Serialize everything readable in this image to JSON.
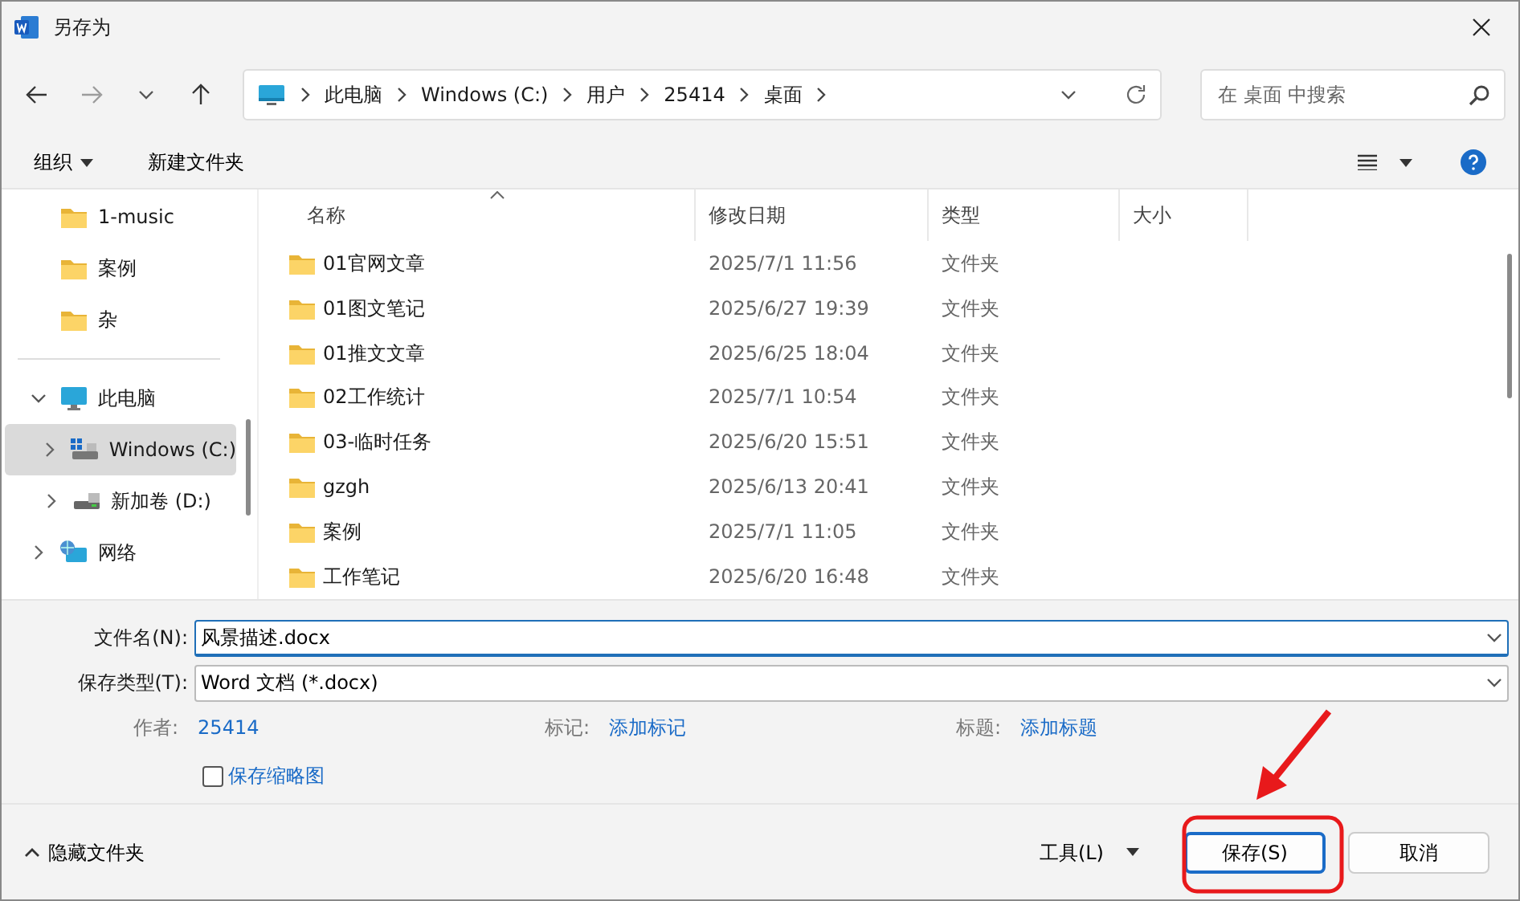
{
  "window": {
    "title": "另存为"
  },
  "nav": {
    "back_disabled": false,
    "forward_disabled": true,
    "breadcrumb": [
      "此电脑",
      "Windows (C:)",
      "用户",
      "25414",
      "桌面"
    ],
    "search": {
      "placeholder": "在 桌面 中搜索"
    }
  },
  "toolbar": {
    "organize": "组织",
    "new_folder": "新建文件夹"
  },
  "sidebar": {
    "items": [
      {
        "label": "1-music",
        "kind": "folder",
        "selected": false
      },
      {
        "label": "案例",
        "kind": "folder",
        "selected": false
      },
      {
        "label": "杂",
        "kind": "folder",
        "selected": false
      },
      {
        "label": "此电脑",
        "kind": "pc",
        "selected": false,
        "expanded": true,
        "children": [
          {
            "label": "Windows (C:)",
            "kind": "system-drive",
            "selected": true,
            "expanded": false
          },
          {
            "label": "新加卷 (D:)",
            "kind": "drive",
            "selected": false,
            "expanded": false
          }
        ]
      },
      {
        "label": "网络",
        "kind": "network",
        "selected": false,
        "expanded": false
      }
    ]
  },
  "table": {
    "columns": [
      {
        "label": "名称",
        "sorted": true
      },
      {
        "label": "修改日期",
        "sorted": false
      },
      {
        "label": "类型",
        "sorted": false
      },
      {
        "label": "大小",
        "sorted": false
      }
    ],
    "rows": [
      {
        "name": "01官网文章",
        "date": "2025/7/1 11:56",
        "type": "文件夹"
      },
      {
        "name": "01图文笔记",
        "date": "2025/6/27 19:39",
        "type": "文件夹"
      },
      {
        "name": "01推文文章",
        "date": "2025/6/25 18:04",
        "type": "文件夹"
      },
      {
        "name": "02工作统计",
        "date": "2025/7/1 10:54",
        "type": "文件夹"
      },
      {
        "name": "03-临时任务",
        "date": "2025/6/20 15:51",
        "type": "文件夹"
      },
      {
        "name": "gzgh",
        "date": "2025/6/13 20:41",
        "type": "文件夹"
      },
      {
        "name": "案例",
        "date": "2025/7/1 11:05",
        "type": "文件夹"
      },
      {
        "name": "工作笔记",
        "date": "2025/6/20 16:48",
        "type": "文件夹"
      }
    ]
  },
  "form": {
    "filename": {
      "label": "文件名(N):",
      "value": "风景描述.docx"
    },
    "filetype": {
      "label": "保存类型(T):",
      "value": "Word 文档 (*.docx)"
    },
    "meta": [
      {
        "label": "作者:",
        "value": "25414"
      },
      {
        "label": "标记:",
        "value": "添加标记"
      },
      {
        "label": "标题:",
        "value": "添加标题"
      }
    ],
    "thumbnail": {
      "label": "保存缩略图",
      "checked": false
    }
  },
  "footer": {
    "hide_folders": "隐藏文件夹",
    "tools": "工具(L)",
    "buttons": [
      {
        "label": "保存(S)",
        "default": true
      },
      {
        "label": "取消",
        "default": false
      }
    ]
  },
  "annotations": [
    {
      "kind": "arrow-to-box"
    }
  ]
}
